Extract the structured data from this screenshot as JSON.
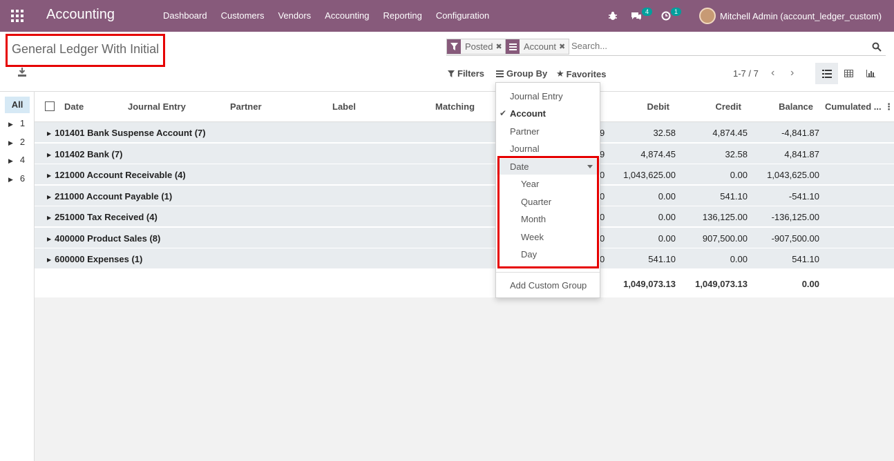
{
  "navbar": {
    "brand": "Accounting",
    "menu": [
      "Dashboard",
      "Customers",
      "Vendors",
      "Accounting",
      "Reporting",
      "Configuration"
    ],
    "messages_count": "4",
    "activities_count": "1",
    "user": "Mitchell Admin (account_ledger_custom)",
    "bg_color": "#875a7b"
  },
  "page": {
    "title": "General Ledger With Initial"
  },
  "search": {
    "facets": [
      {
        "icon": "filter-icon",
        "label": "Posted"
      },
      {
        "icon": "group-by-icon",
        "label": "Account"
      }
    ],
    "placeholder": "Search..."
  },
  "buttons": {
    "filters": "Filters",
    "group_by": "Group By",
    "favorites": "Favorites"
  },
  "pager": {
    "value": "1-7 / 7"
  },
  "sidepanel": {
    "all": "All",
    "items": [
      "1",
      "2",
      "4",
      "6"
    ]
  },
  "table": {
    "columns": {
      "date": "Date",
      "journal_entry": "Journal Entry",
      "partner": "Partner",
      "label": "Label",
      "matching": "Matching",
      "debit": "Debit",
      "credit": "Credit",
      "balance": "Balance",
      "cumulated": "Cumulated ..."
    },
    "groups": [
      {
        "name": "101401 Bank Suspense Account (7)",
        "partial": "9",
        "debit": "32.58",
        "credit": "4,874.45",
        "balance": "-4,841.87"
      },
      {
        "name": "101402 Bank (7)",
        "partial": "9",
        "debit": "4,874.45",
        "credit": "32.58",
        "balance": "4,841.87"
      },
      {
        "name": "121000 Account Receivable (4)",
        "partial": "0",
        "debit": "1,043,625.00",
        "credit": "0.00",
        "balance": "1,043,625.00"
      },
      {
        "name": "211000 Account Payable (1)",
        "partial": "0",
        "debit": "0.00",
        "credit": "541.10",
        "balance": "-541.10"
      },
      {
        "name": "251000 Tax Received (4)",
        "partial": "0",
        "debit": "0.00",
        "credit": "136,125.00",
        "balance": "-136,125.00"
      },
      {
        "name": "400000 Product Sales (8)",
        "partial": "0",
        "debit": "0.00",
        "credit": "907,500.00",
        "balance": "-907,500.00"
      },
      {
        "name": "600000 Expenses (1)",
        "partial": "0",
        "debit": "541.10",
        "credit": "0.00",
        "balance": "541.10"
      }
    ],
    "totals": {
      "debit": "1,049,073.13",
      "credit": "1,049,073.13",
      "balance": "0.00"
    }
  },
  "group_by_menu": {
    "items": [
      "Journal Entry",
      "Account",
      "Partner",
      "Journal"
    ],
    "selected": "Account",
    "date_label": "Date",
    "date_options": [
      "Year",
      "Quarter",
      "Month",
      "Week",
      "Day"
    ],
    "add_custom": "Add Custom Group"
  }
}
